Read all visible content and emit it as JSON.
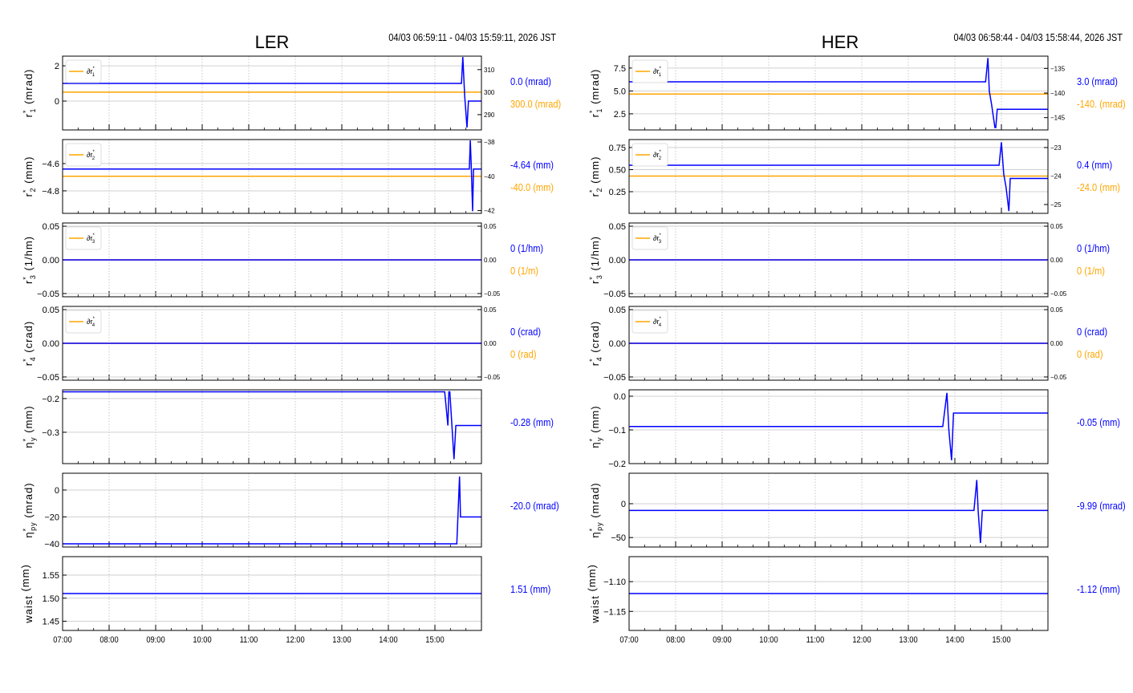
{
  "chart_data": {
    "type": "line",
    "xlim": [
      7,
      16
    ],
    "x_ticks": [
      7,
      8,
      9,
      10,
      11,
      12,
      13,
      14,
      15
    ],
    "x_tick_labels": [
      "07:00",
      "08:00",
      "09:00",
      "10:00",
      "11:00",
      "12:00",
      "13:00",
      "14:00",
      "15:00"
    ],
    "colors": {
      "measured": "#0000ff",
      "reference": "#ffa500"
    },
    "panels": [
      {
        "title": "LER",
        "time_range": "04/03 06:59:11 - 04/03 15:59:11, 2026 JST",
        "rows": [
          {
            "ylabel": {
              "base": "r",
              "sup": "*",
              "sub": "1",
              "unit": " (mrad)"
            },
            "ylim": [
              -1.64,
              2.55
            ],
            "yticks": [
              0,
              2
            ],
            "yticklabels": [
              "0",
              "2"
            ],
            "right": {
              "ylim": [
                283.2,
                316
              ],
              "ticks": [
                290,
                300,
                310
              ],
              "labels": [
                "290",
                "300",
                "310"
              ]
            },
            "legend": {
              "base": "∂r",
              "sup": "*",
              "sub": "1"
            },
            "series": [
              [
                7,
                1
              ],
              [
                15.57,
                1
              ],
              [
                15.6,
                2.5
              ],
              [
                15.64,
                0.3
              ],
              [
                15.69,
                -1.5
              ],
              [
                15.72,
                0
              ],
              [
                16,
                0
              ]
            ],
            "reference": 300,
            "value_label": "0.0 (mrad)",
            "reference_label": "300.0 (mrad)"
          },
          {
            "ylabel": {
              "base": "r",
              "sup": "*",
              "sub": "2",
              "unit": " (mm)"
            },
            "ylim": [
              -4.965,
              -4.424
            ],
            "yticks": [
              -4.8,
              -4.6
            ],
            "yticklabels": [
              "−4.8",
              "−4.6"
            ],
            "right": {
              "ylim": [
                -42.16,
                -37.86
              ],
              "ticks": [
                -42,
                -40,
                -38
              ],
              "labels": [
                "−42",
                "−40",
                "−38"
              ]
            },
            "legend": {
              "base": "∂r",
              "sup": "*",
              "sub": "2"
            },
            "series": [
              [
                7,
                -4.64
              ],
              [
                15.74,
                -4.64
              ],
              [
                15.76,
                -4.43
              ],
              [
                15.78,
                -4.6
              ],
              [
                15.81,
                -4.95
              ],
              [
                15.83,
                -4.64
              ],
              [
                16,
                -4.64
              ]
            ],
            "reference": -40,
            "value_label": "-4.64 (mm)",
            "reference_label": "-40.0 (mm)"
          },
          {
            "ylabel": {
              "base": "r",
              "sup": "*",
              "sub": "3",
              "unit": " (1/hm)"
            },
            "ylim": [
              -0.0548,
              0.0548
            ],
            "yticks": [
              -0.05,
              0,
              0.05
            ],
            "yticklabels": [
              "−0.05",
              "0.00",
              "0.05"
            ],
            "right": {
              "ylim": [
                -0.0548,
                0.0548
              ],
              "ticks": [
                -0.05,
                0,
                0.05
              ],
              "labels": [
                "−0.05",
                "0.00",
                "0.05"
              ]
            },
            "legend": {
              "base": "∂r",
              "sup": "*",
              "sub": "3"
            },
            "series": [
              [
                7,
                0
              ],
              [
                16,
                0
              ]
            ],
            "reference": 0,
            "value_label": "0 (1/hm)",
            "reference_label": "0 (1/m)"
          },
          {
            "ylabel": {
              "base": "r",
              "sup": "*",
              "sub": "4",
              "unit": " (crad)"
            },
            "ylim": [
              -0.0548,
              0.0548
            ],
            "yticks": [
              -0.05,
              0,
              0.05
            ],
            "yticklabels": [
              "−0.05",
              "0.00",
              "0.05"
            ],
            "right": {
              "ylim": [
                -0.0548,
                0.0548
              ],
              "ticks": [
                -0.05,
                0,
                0.05
              ],
              "labels": [
                "−0.05",
                "0.00",
                "0.05"
              ]
            },
            "legend": {
              "base": "∂r",
              "sup": "*",
              "sub": "4"
            },
            "series": [
              [
                7,
                0
              ],
              [
                16,
                0
              ]
            ],
            "reference": 0,
            "value_label": "0 (crad)",
            "reference_label": "0 (rad)"
          },
          {
            "ylabel": {
              "base": "η",
              "sup": "*",
              "sub": "y",
              "unit": " (mm)"
            },
            "ylim": [
              -0.393,
              -0.174
            ],
            "yticks": [
              -0.3,
              -0.2
            ],
            "yticklabels": [
              "−0.3",
              "−0.2"
            ],
            "series": [
              [
                7,
                -0.18
              ],
              [
                15.21,
                -0.18
              ],
              [
                15.28,
                -0.28
              ],
              [
                15.3,
                -0.18
              ],
              [
                15.32,
                -0.18
              ],
              [
                15.41,
                -0.38
              ],
              [
                15.45,
                -0.28
              ],
              [
                16,
                -0.28
              ]
            ],
            "value_label": "-0.28 (mm)"
          },
          {
            "ylabel": {
              "base": "η",
              "sup": "*",
              "sub": "py",
              "unit": " (mrad)"
            },
            "ylim": [
              -42.4,
              12.5
            ],
            "yticks": [
              -40,
              -20,
              0
            ],
            "yticklabels": [
              "−40",
              "−20",
              "0"
            ],
            "series": [
              [
                7,
                -40
              ],
              [
                15.47,
                -40
              ],
              [
                15.53,
                10
              ],
              [
                15.55,
                -20
              ],
              [
                16,
                -20
              ]
            ],
            "value_label": "-20.0 (mrad)"
          },
          {
            "ylabel": {
              "base": "waist",
              "sup": "",
              "sub": "",
              "unit": " (mm)"
            },
            "ylim": [
              1.43,
              1.59
            ],
            "yticks": [
              1.45,
              1.5,
              1.55
            ],
            "yticklabels": [
              "1.45",
              "1.50",
              "1.55"
            ],
            "series": [
              [
                7,
                1.51
              ],
              [
                16,
                1.51
              ]
            ],
            "value_label": "1.51 (mm)"
          }
        ]
      },
      {
        "title": "HER",
        "time_range": "04/03 06:58:44 - 04/03 15:58:44, 2026 JST",
        "rows": [
          {
            "ylabel": {
              "base": "r",
              "sup": "*",
              "sub": "1",
              "unit": " (mrad)"
            },
            "ylim": [
              0.74,
              8.8
            ],
            "yticks": [
              2.5,
              5,
              7.5
            ],
            "yticklabels": [
              "2.5",
              "5.0",
              "7.5"
            ],
            "right": {
              "ylim": [
                -147.5,
                -132.5
              ],
              "ticks": [
                -145,
                -140,
                -135
              ],
              "labels": [
                "−145",
                "−140",
                "−135"
              ]
            },
            "legend": {
              "base": "∂r",
              "sup": "*",
              "sub": "1"
            },
            "series": [
              [
                7,
                6
              ],
              [
                14.66,
                6
              ],
              [
                14.71,
                8.6
              ],
              [
                14.74,
                5
              ],
              [
                14.79,
                3.5
              ],
              [
                14.86,
                1
              ],
              [
                14.88,
                1
              ],
              [
                14.91,
                3
              ],
              [
                16,
                3
              ]
            ],
            "reference": -140.2,
            "value_label": "3.0 (mrad)",
            "reference_label": "-140. (mrad)"
          },
          {
            "ylabel": {
              "base": "r",
              "sup": "*",
              "sub": "2",
              "unit": " (mm)"
            },
            "ylim": [
              0.005,
              0.84
            ],
            "yticks": [
              0.25,
              0.5,
              0.75
            ],
            "yticklabels": [
              "0.25",
              "0.50",
              "0.75"
            ],
            "right": {
              "ylim": [
                -25.31,
                -22.72
              ],
              "ticks": [
                -25,
                -24,
                -23
              ],
              "labels": [
                "−25",
                "−24",
                "−23"
              ]
            },
            "legend": {
              "base": "∂r",
              "sup": "*",
              "sub": "2"
            },
            "series": [
              [
                7,
                0.55
              ],
              [
                14.95,
                0.55
              ],
              [
                15,
                0.81
              ],
              [
                15.05,
                0.45
              ],
              [
                15.1,
                0.3
              ],
              [
                15.16,
                0.03
              ],
              [
                15.19,
                0.4
              ],
              [
                16,
                0.4
              ]
            ],
            "reference": -24,
            "value_label": "0.4 (mm)",
            "reference_label": "-24.0 (mm)"
          },
          {
            "ylabel": {
              "base": "r",
              "sup": "*",
              "sub": "3",
              "unit": " (1/hm)"
            },
            "ylim": [
              -0.0548,
              0.0548
            ],
            "yticks": [
              -0.05,
              0,
              0.05
            ],
            "yticklabels": [
              "−0.05",
              "0.00",
              "0.05"
            ],
            "right": {
              "ylim": [
                -0.0548,
                0.0548
              ],
              "ticks": [
                -0.05,
                0,
                0.05
              ],
              "labels": [
                "−0.05",
                "0.00",
                "0.05"
              ]
            },
            "legend": {
              "base": "∂r",
              "sup": "*",
              "sub": "3"
            },
            "series": [
              [
                7,
                0
              ],
              [
                16,
                0
              ]
            ],
            "reference": 0,
            "value_label": "0 (1/hm)",
            "reference_label": "0 (1/m)"
          },
          {
            "ylabel": {
              "base": "r",
              "sup": "*",
              "sub": "4",
              "unit": " (crad)"
            },
            "ylim": [
              -0.0548,
              0.0548
            ],
            "yticks": [
              -0.05,
              0,
              0.05
            ],
            "yticklabels": [
              "−0.05",
              "0.00",
              "0.05"
            ],
            "right": {
              "ylim": [
                -0.0548,
                0.0548
              ],
              "ticks": [
                -0.05,
                0,
                0.05
              ],
              "labels": [
                "−0.05",
                "0.00",
                "0.05"
              ]
            },
            "legend": {
              "base": "∂r",
              "sup": "*",
              "sub": "4"
            },
            "series": [
              [
                7,
                0
              ],
              [
                16,
                0
              ]
            ],
            "reference": 0,
            "value_label": "0 (crad)",
            "reference_label": "0 (rad)"
          },
          {
            "ylabel": {
              "base": "η",
              "sup": "*",
              "sub": "y",
              "unit": " (mm)"
            },
            "ylim": [
              -0.2,
              0.019
            ],
            "yticks": [
              -0.2,
              -0.1,
              0
            ],
            "yticklabels": [
              "−0.2",
              "−0.1",
              "0.0"
            ],
            "series": [
              [
                7,
                -0.09
              ],
              [
                13.74,
                -0.09
              ],
              [
                13.83,
                0.01
              ],
              [
                13.87,
                -0.1
              ],
              [
                13.93,
                -0.19
              ],
              [
                13.97,
                -0.05
              ],
              [
                16,
                -0.05
              ]
            ],
            "value_label": "-0.05 (mm)"
          },
          {
            "ylabel": {
              "base": "η",
              "sup": "*",
              "sub": "py",
              "unit": " (mrad)"
            },
            "ylim": [
              -64,
              45
            ],
            "yticks": [
              -50,
              0
            ],
            "yticklabels": [
              "−50",
              "0"
            ],
            "series": [
              [
                7,
                -10
              ],
              [
                14.41,
                -10
              ],
              [
                14.47,
                35
              ],
              [
                14.5,
                -10
              ],
              [
                14.55,
                -58
              ],
              [
                14.59,
                -10
              ],
              [
                16,
                -10
              ]
            ],
            "value_label": "-9.99 (mrad)"
          },
          {
            "ylabel": {
              "base": "waist",
              "sup": "",
              "sub": "",
              "unit": " (mm)"
            },
            "ylim": [
              -1.182,
              -1.058
            ],
            "yticks": [
              -1.15,
              -1.1
            ],
            "yticklabels": [
              "−1.15",
              "−1.10"
            ],
            "series": [
              [
                7,
                -1.12
              ],
              [
                16,
                -1.12
              ]
            ],
            "value_label": "-1.12 (mm)"
          }
        ]
      }
    ]
  }
}
